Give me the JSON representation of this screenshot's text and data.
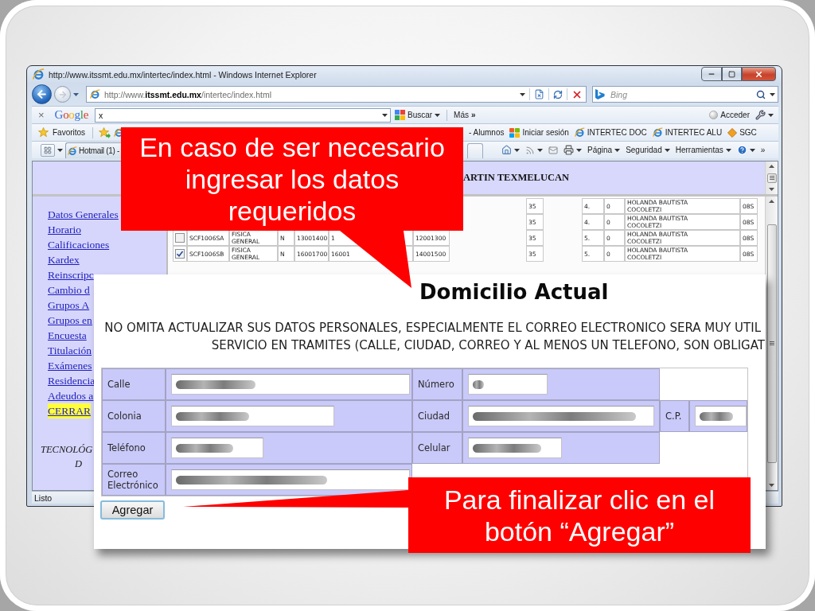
{
  "browser": {
    "title": "http://www.itssmt.edu.mx/intertec/index.html - Windows Internet Explorer",
    "address": "http://www.**itssmt.edu.mx**/intertec/index.html",
    "search": {
      "placeholder": "Bing"
    },
    "google_toolbar": {
      "close": "×",
      "logo": "Google",
      "query": "x",
      "search_button": "Buscar",
      "more": "Más **»**",
      "sign_in": "Acceder"
    },
    "favorites_bar": {
      "label": "Favoritos",
      "links": [
        {
          "label": "- Alumnos",
          "kind": "plain"
        },
        {
          "label": "Iniciar sesión",
          "kind": "flag"
        },
        {
          "label": "INTERTEC DOC",
          "kind": "page"
        },
        {
          "label": "INTERTEC ALU",
          "kind": "page"
        },
        {
          "label": "SGC",
          "kind": "diamond"
        }
      ]
    },
    "tabs": [
      {
        "label": "Hotmail (1) -",
        "selected": false
      }
    ],
    "command_bar": {
      "menus": [
        "Página",
        "Seguridad",
        "Herramientas"
      ],
      "overflow": "»"
    },
    "status_bar": "Listo"
  },
  "page": {
    "header": "ARTIN TEXMELUCAN",
    "menu": [
      {
        "label": "Datos Generales",
        "highlighted": false
      },
      {
        "label": "Horario",
        "highlighted": false
      },
      {
        "label": "Calificaciones",
        "highlighted": false
      },
      {
        "label": "Kardex",
        "highlighted": false
      },
      {
        "label": "Reinscripc",
        "highlighted": false
      },
      {
        "label": "Cambio d",
        "highlighted": false
      },
      {
        "label": "Grupos A",
        "highlighted": false
      },
      {
        "label": "Grupos en",
        "highlighted": false
      },
      {
        "label": "Encuesta",
        "highlighted": false
      },
      {
        "label": "Titulación",
        "highlighted": false
      },
      {
        "label": "Exámenes",
        "highlighted": false
      },
      {
        "label": "Residencia",
        "highlighted": false
      },
      {
        "label": "Adeudos a",
        "highlighted": false
      },
      {
        "label": "CERRAR",
        "highlighted": true
      }
    ],
    "footer": [
      "TECNOLÓG",
      "D"
    ],
    "courses": [
      {
        "column_9": "35",
        "column_11": "4.",
        "column_12": "0",
        "column_13": "HOLANDA BAUTISTA COCOLETZI",
        "column_14": "08S"
      },
      {
        "column_9": "35",
        "column_11": "4.",
        "column_12": "0",
        "column_13": "HOLANDA BAUTISTA COCOLETZI",
        "column_14": "08S"
      },
      {
        "checked": false,
        "column_2": "SCF1006SA",
        "column_3": "FISICA GENERAL",
        "column_4": "N",
        "column_5": "13001400",
        "column_6": "1",
        "column_7": "12001300",
        "column_9": "35",
        "column_11": "5.",
        "column_12": "0",
        "column_13": "HOLANDA BAUTISTA COCOLETZI",
        "column_14": "08S"
      },
      {
        "checked": true,
        "column_2": "SCF1006SB",
        "column_3": "FISICA GENERAL",
        "column_4": "N",
        "column_5": "16001700",
        "column_6": "16001",
        "column_7": "14001500",
        "column_9": "35",
        "column_11": "5.",
        "column_12": "0",
        "column_13": "HOLANDA BAUTISTA COCOLETZI",
        "column_14": "08S"
      }
    ]
  },
  "form": {
    "title": "Domicilio Actual",
    "notice": [
      "NO OMITA ACTUALIZAR SUS DATOS PERSONALES, ESPECIALMENTE EL CORREO ELECTRONICO SERA MUY UTIL",
      "SERVICIO EN TRAMITES (CALLE, CIUDAD, CORREO Y AL MENOS UN TELEFONO, SON OBLIGAT"
    ],
    "rows": [
      {
        "fields": [
          {
            "label": "Calle",
            "redacted": true
          },
          {
            "label": "Número",
            "redacted": true
          }
        ]
      },
      {
        "fields": [
          {
            "label": "Colonia",
            "redacted": true
          },
          {
            "label": "Ciudad",
            "redacted": true
          },
          {
            "label": "C.P.",
            "redacted": true
          }
        ]
      },
      {
        "fields": [
          {
            "label": "Teléfono",
            "redacted": true
          },
          {
            "label": "Celular",
            "redacted": true
          }
        ]
      },
      {
        "fields": [
          {
            "label": "Correo Electrónico",
            "redacted": true
          }
        ]
      }
    ],
    "submit": "Agregar"
  },
  "callouts": [
    {
      "text": "En caso de ser necesario ingresar los datos requeridos",
      "kind": "down"
    },
    {
      "text": "Para finalizar clic en el botón “Agregar”",
      "kind": "left"
    }
  ]
}
